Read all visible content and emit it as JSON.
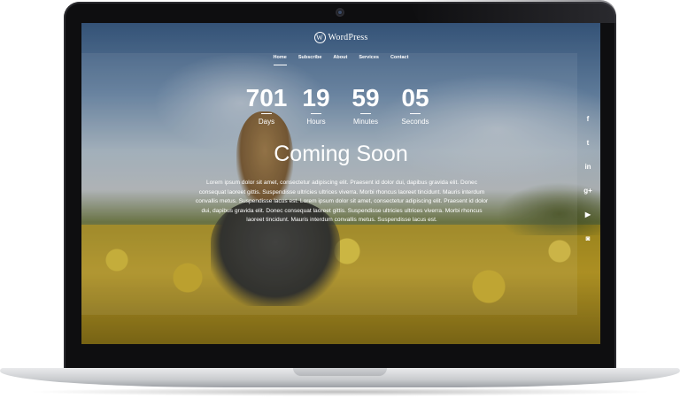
{
  "site": {
    "logo_mark": "W",
    "logo_text": "WordPress"
  },
  "nav": {
    "items": [
      {
        "label": "Home",
        "active": true
      },
      {
        "label": "Subscribe",
        "active": false
      },
      {
        "label": "About",
        "active": false
      },
      {
        "label": "Services",
        "active": false
      },
      {
        "label": "Contact",
        "active": false
      }
    ]
  },
  "countdown": {
    "days": {
      "value": "701",
      "label": "Days"
    },
    "hours": {
      "value": "19",
      "label": "Hours"
    },
    "minutes": {
      "value": "59",
      "label": "Minutes"
    },
    "seconds": {
      "value": "05",
      "label": "Seconds"
    }
  },
  "main": {
    "title": "Coming Soon",
    "body": "Lorem ipsum dolor sit amet, consectetur adipiscing elit. Praesent id dolor dui, dapibus gravida elit. Donec consequat laoreet gittis. Suspendisse ultricies ultrices viverra. Morbi rhoncus laoreet tincidunt. Mauris interdum convallis metus. Suspendisse lacus est. Lorem ipsum dolor sit amet, consectetur adipiscing elit. Praesent id dolor dui, dapibus gravida elit. Donec consequat laoreet gittis. Suspendisse ultricies ultrices viverra. Morbi rhoncus laoreet tincidunt. Mauris interdum convallis metus. Suspendisse lacus est."
  },
  "social": {
    "icons": [
      {
        "name": "facebook-icon",
        "glyph": "f"
      },
      {
        "name": "twitter-icon",
        "glyph": "t"
      },
      {
        "name": "linkedin-icon",
        "glyph": "in"
      },
      {
        "name": "google-plus-icon",
        "glyph": "g+"
      },
      {
        "name": "youtube-icon",
        "glyph": "▶"
      },
      {
        "name": "instagram-icon",
        "glyph": "◙"
      }
    ]
  },
  "colors": {
    "text": "#ffffff",
    "bezel": "#0e0e10",
    "field_yellow": "#d4b021",
    "sky_blue": "#6e8fb3"
  }
}
